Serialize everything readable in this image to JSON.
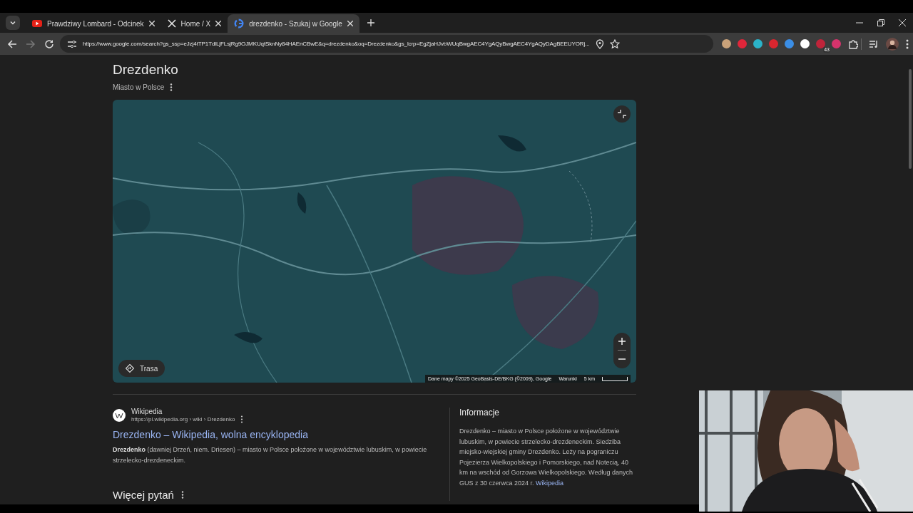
{
  "tabs": [
    {
      "title": "Prawdziwy Lombard - Odcinek",
      "selected": false
    },
    {
      "title": "Home / X",
      "selected": false
    },
    {
      "title": "drezdenko - Szukaj w Google",
      "selected": true
    }
  ],
  "address_bar": {
    "url": "https://www.google.com/search?gs_ssp=eJzj4tTP1TdlLjFLsjRg9OJMKUqtSknNy84HAEnCBwE&q=drezdenko&oq=Drezdenko&gs_lcrp=EgZjaHJvbWUqBwgAEC4YgAQyBwgAEC4YgAQyDAgBEEUYORj..."
  },
  "extensions": [
    {
      "color": "#c9a27a"
    },
    {
      "color": "#e0263a"
    },
    {
      "color": "#2bb3c9"
    },
    {
      "color": "#d9262f"
    },
    {
      "color": "#3b8ee6"
    },
    {
      "color": "#ffffff"
    },
    {
      "color": "#c0243a",
      "badge": "43"
    },
    {
      "color": "#d6336c"
    }
  ],
  "place": {
    "title": "Drezdenko",
    "subtitle": "Miasto w Polsce"
  },
  "map": {
    "kind": "picture",
    "route_button": "Trasa",
    "attribution": "Dane mapy ©2025 GeoBasis-DE/BKG (©2009), Google",
    "terms": "Warunki",
    "scale": "5 km"
  },
  "result": {
    "source": "Wikipedia",
    "breadcrumb": "https://pl.wikipedia.org › wiki › Drezdenko",
    "title": "Drezdenko – Wikipedia, wolna encyklopedia",
    "snippet": "**Drezdenko** (dawniej Drzeń, niem. Driesen) – miasto w Polsce położone w województwie lubuskim, w powiecie strzelecko-drezdeneckim."
  },
  "more_questions": {
    "title": "Więcej pytań"
  },
  "info": {
    "title": "Informacje",
    "text": "Drezdenko – miasto w Polsce położone w województwie lubuskim, w powiecie strzelecko-drezdeneckim. Siedziba miejsko-wiejskiej gminy Drezdenko. Leży na pograniczu Pojezierza Wielkopolskiego i Pomorskiego, nad Notecią, 40 km na wschód od Gorzowa Wielkopolskiego. Według danych GUS z 30 czerwca 2024 r.",
    "link": "Wikipedia"
  }
}
